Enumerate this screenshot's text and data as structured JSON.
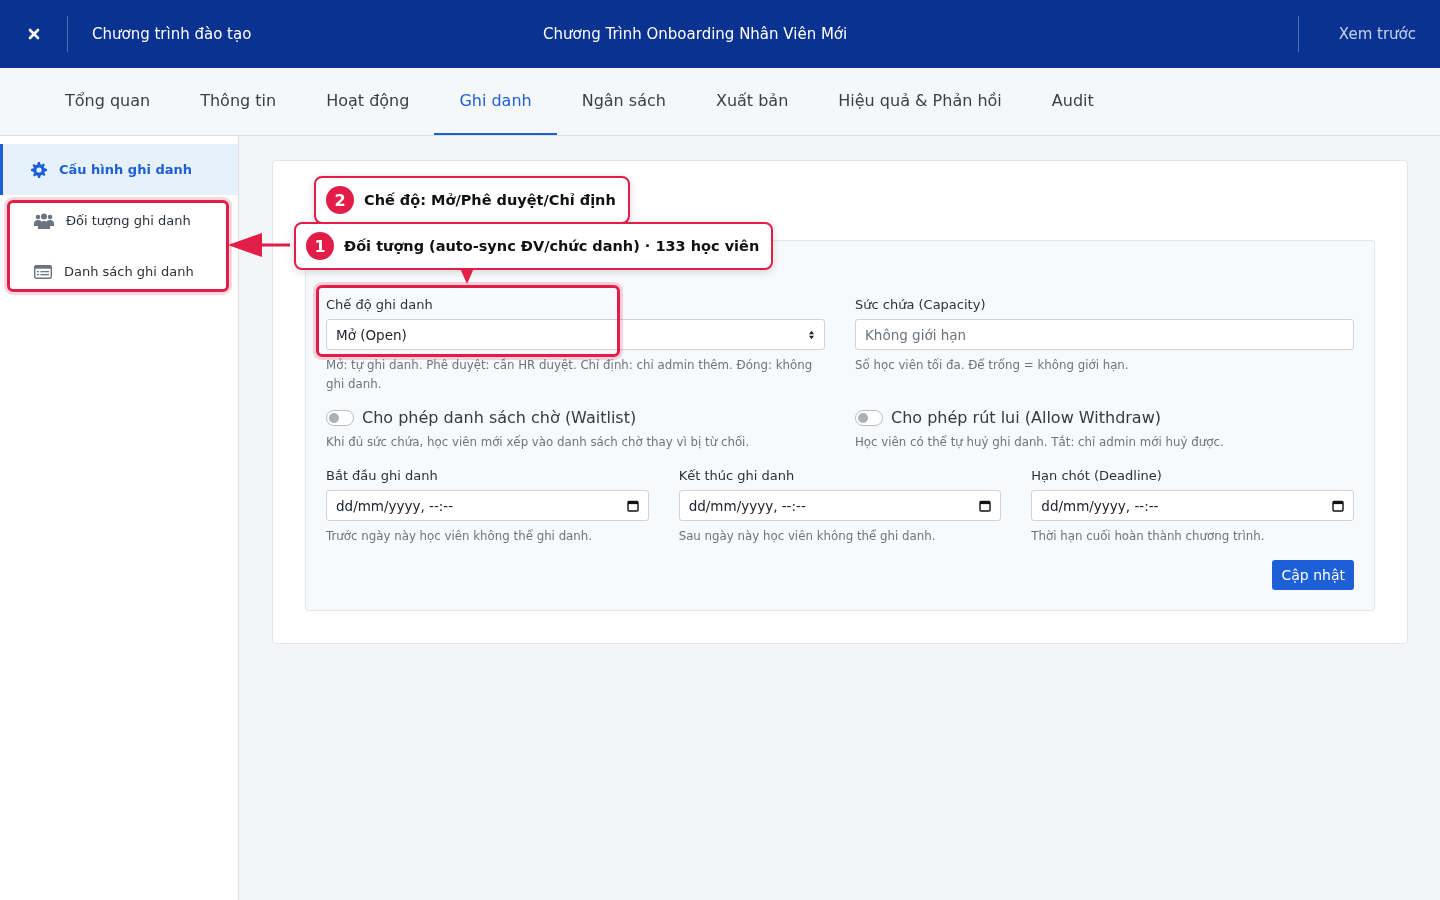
{
  "header": {
    "section_title": "Chương trình đào tạo",
    "program_title": "Chương Trình Onboarding Nhân Viên Mới",
    "preview_link": "Xem trước"
  },
  "tabs": [
    {
      "label": "Tổng quan",
      "selected": false
    },
    {
      "label": "Thông tin",
      "selected": false
    },
    {
      "label": "Hoạt động",
      "selected": false
    },
    {
      "label": "Ghi danh",
      "selected": true
    },
    {
      "label": "Ngân sách",
      "selected": false
    },
    {
      "label": "Xuất bản",
      "selected": false
    },
    {
      "label": "Hiệu quả & Phản hồi",
      "selected": false
    },
    {
      "label": "Audit",
      "selected": false
    }
  ],
  "sidebar": {
    "items": [
      {
        "label": "Cấu hình ghi danh",
        "kind": "gear",
        "selected": true
      },
      {
        "label": "Đối tượng ghi danh",
        "kind": "users",
        "selected": false
      },
      {
        "label": "Danh sách ghi danh",
        "kind": "list",
        "selected": false
      }
    ]
  },
  "card": {
    "mode": {
      "label": "Chế độ ghi danh",
      "value": "Mở (Open)",
      "hint": "Mở: tự ghi danh. Phê duyệt: cần HR duyệt. Chỉ định: chỉ admin thêm. Đóng: không ghi danh."
    },
    "capacity": {
      "label": "Sức chứa (Capacity)",
      "placeholder": "Không giới hạn",
      "hint": "Số học viên tối đa. Để trống = không giới hạn."
    },
    "toggles": [
      {
        "label": "Cho phép danh sách chờ (Waitlist)",
        "on": false,
        "hint": "Khi đủ sức chứa, học viên mới xếp vào danh sách chờ thay vì bị từ chối."
      },
      {
        "label": "Cho phép rút lui (Allow Withdraw)",
        "on": false,
        "hint": "Học viên có thể tự huỷ ghi danh. Tắt: chỉ admin mới huỷ được."
      }
    ],
    "dates": [
      {
        "label": "Bắt đầu ghi danh",
        "placeholder": "dd/mm/yyyy, --:--",
        "hint": "Trước ngày này học viên không thể ghi danh."
      },
      {
        "label": "Kết thúc ghi danh",
        "placeholder": "dd/mm/yyyy, --:--",
        "hint": "Sau ngày này học viên không thể ghi danh."
      },
      {
        "label": "Hạn chót (Deadline)",
        "placeholder": "dd/mm/yyyy, --:--",
        "hint": "Thời hạn cuối hoàn thành chương trình."
      }
    ],
    "submit": "Cập nhật"
  },
  "callouts": [
    {
      "number": "2",
      "text": "Chế độ: Mở/Phê duyệt/Chỉ định",
      "kind": "plain"
    },
    {
      "number": "1",
      "text": "Đối tượng (auto-sync ĐV/chức danh) · 133 học viên",
      "kind": "pointer"
    }
  ]
}
